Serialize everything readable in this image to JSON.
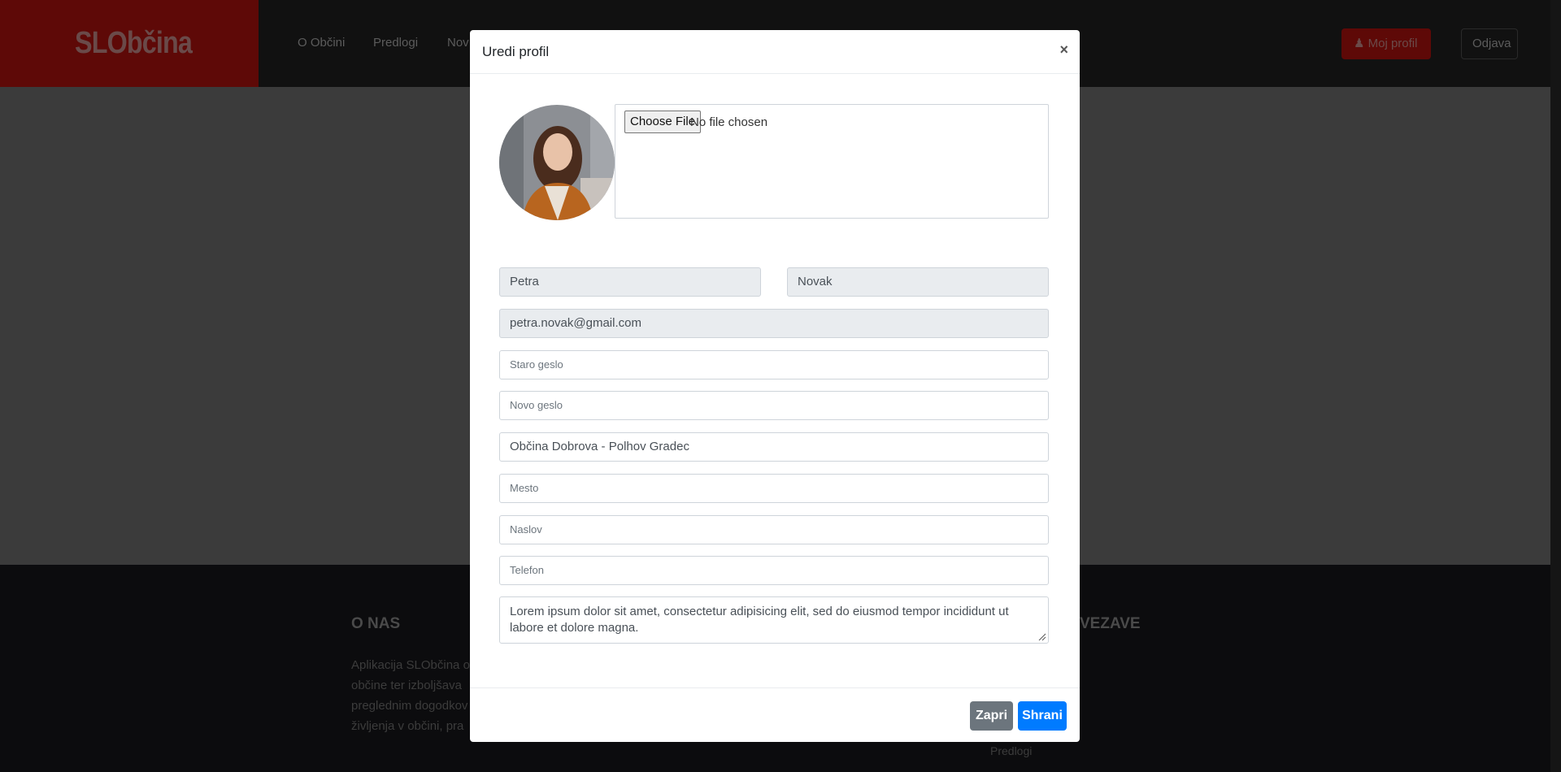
{
  "app": {
    "brand": "SLObčina"
  },
  "nav": {
    "items": [
      "O Občini",
      "Predlogi",
      "Nov"
    ]
  },
  "header_actions": {
    "profile_label": "Moj profil",
    "logout_label": "Odjava"
  },
  "footer": {
    "about_heading": "O NAS",
    "links_heading": "VEZAVE",
    "about_text": "Aplikacija SLObčina o\nobčine ter izboljšava\npreglednim dogodkov\nživljenja v občini, pra",
    "link_partial": "Predlogi"
  },
  "modal": {
    "title": "Uredi profil",
    "close_symbol": "×",
    "file_input": {
      "button_label": "Choose File",
      "status": "No file chosen"
    },
    "fields": {
      "first_name": "Petra",
      "last_name": "Novak",
      "email": "petra.novak@gmail.com",
      "old_password_placeholder": "Staro geslo",
      "new_password_placeholder": "Novo geslo",
      "municipality": "Občina Dobrova - Polhov Gradec",
      "city_placeholder": "Mesto",
      "address_placeholder": "Naslov",
      "phone_placeholder": "Telefon",
      "bio": "Lorem ipsum dolor sit amet, consectetur adipisicing elit, sed do eiusmod tempor incididunt ut labore et dolore magna."
    },
    "buttons": {
      "close_label": "Zapri",
      "save_label": "Shrani"
    }
  },
  "colors": {
    "primary": "#007bff",
    "secondary": "#6c757d",
    "brand_red": "#5e0907"
  },
  "icons": [
    "user-icon",
    "close-icon",
    "resize-handle-icon"
  ]
}
